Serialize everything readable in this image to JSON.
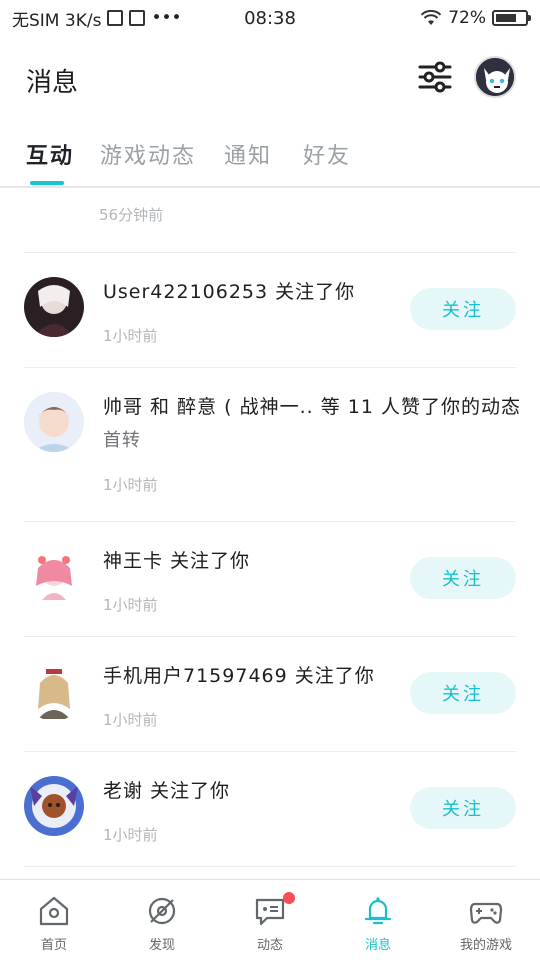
{
  "status_bar": {
    "carrier": "无SIM 3K/s",
    "time": "08:38",
    "battery_pct": "72%",
    "battery_level": 0.72
  },
  "header": {
    "title": "消息"
  },
  "tabs": [
    {
      "label": "互动",
      "active": true
    },
    {
      "label": "游戏动态",
      "active": false
    },
    {
      "label": "通知",
      "active": false
    },
    {
      "label": "好友",
      "active": false
    }
  ],
  "list": {
    "orphan_time": "56分钟前",
    "items": [
      {
        "title": "User422106253 关注了你",
        "sub": "",
        "time": "1小时前",
        "button": "关注"
      },
      {
        "title": "帅哥 和 醉意 ( 战神一.. 等 11 人赞了你的动态",
        "sub": "首转",
        "time": "1小时前",
        "button": ""
      },
      {
        "title": "神王卡 关注了你",
        "sub": "",
        "time": "1小时前",
        "button": "关注"
      },
      {
        "title": "手机用户71597469 关注了你",
        "sub": "",
        "time": "1小时前",
        "button": "关注"
      },
      {
        "title": "老谢 关注了你",
        "sub": "",
        "time": "1小时前",
        "button": "关注"
      }
    ]
  },
  "bottom_nav": [
    {
      "label": "首页",
      "icon": "home-icon"
    },
    {
      "label": "发现",
      "icon": "discover-icon"
    },
    {
      "label": "动态",
      "icon": "feed-icon",
      "badge": true
    },
    {
      "label": "消息",
      "icon": "bell-icon",
      "active": true
    },
    {
      "label": "我的游戏",
      "icon": "gamepad-icon"
    }
  ],
  "colors": {
    "accent": "#17c0cb",
    "follow_bg": "#e6f7f9",
    "badge": "#f54f55"
  }
}
